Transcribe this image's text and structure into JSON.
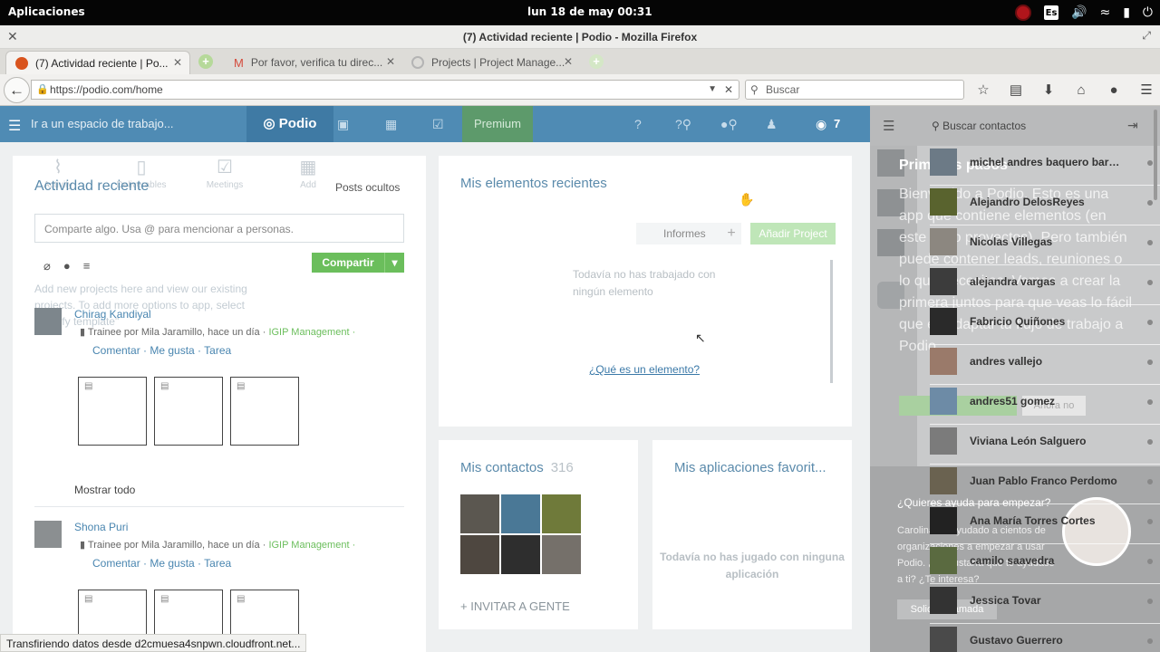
{
  "os_bar": {
    "apps_label": "Aplicaciones",
    "clock": "lun 18 de may   00:31",
    "kbd_layout": "Es"
  },
  "window": {
    "title": "(7) Actividad reciente | Podio - Mozilla Firefox"
  },
  "tabs": [
    {
      "label": "(7) Actividad reciente | Po...",
      "active": true,
      "favicon_color": "#d9541e"
    },
    {
      "label": "Por favor, verifica tu direc...",
      "active": false,
      "favicon_color": "#d44b3c"
    },
    {
      "label": "Projects | Project Manage...",
      "active": false,
      "favicon_color": "#b4b4b4"
    }
  ],
  "navbar": {
    "url": "https://podio.com/home",
    "search_placeholder": "Buscar"
  },
  "podio_header": {
    "workspace_placeholder": "Ir a un espacio de trabajo...",
    "logo": "Podio",
    "premium": "Premium",
    "notifications_count": "7"
  },
  "activity": {
    "ghost_tabs": [
      "Activity",
      "Deliverables",
      "Meetings",
      "Add"
    ],
    "title": "Actividad reciente",
    "hidden_posts": "Posts ocultos",
    "share_placeholder": "Comparte algo. Usa @ para mencionar a personas.",
    "share_button": "Compartir",
    "ghost_text": "Add new projects here and view our existing projects. To add more options to app, select \"Modify template\"",
    "posts": [
      {
        "name": "Chirag Kandiyal",
        "meta": "Trainee por Mila Jaramillo, hace un día · ",
        "workspace": "IGIP Management ·",
        "actions": "Comentar · Me gusta · Tarea"
      },
      {
        "name": "Shona Puri",
        "meta": "Trainee por Mila Jaramillo, hace un día · ",
        "workspace": "IGIP Management ·",
        "actions": "Comentar · Me gusta · Tarea"
      }
    ],
    "show_all": "Mostrar todo"
  },
  "recent_items": {
    "title": "Mis elementos recientes",
    "reports": "Informes",
    "add_project": "Añadir Project",
    "empty": "Todavía no has trabajado con ningún elemento",
    "what_link": "¿Qué es un elemento?"
  },
  "contacts_card": {
    "title": "Mis contactos",
    "count": "316",
    "invite": "+ INVITAR A GENTE"
  },
  "apps_card": {
    "title": "Mis aplicaciones favorit...",
    "empty": "Todavía no has jugado con ninguna aplicación"
  },
  "status_bar": "Transfiriendo datos desde d2cmuesa4snpwn.cloudfront.net...",
  "sidebar": {
    "search_placeholder": "Buscar contactos",
    "ghost_heading": "Primeros pasos",
    "ghost_para": "Bienvenido a Podio. Esto es una app que contiene elementos (en este caso proyectos). Pero también puede contener leads, reuniones o lo que necesites. Vamos a crear la primera juntos para que veas lo fácil que es adaptar tu flujo de trabajo a Podio.",
    "ghost_btn_secondary": "Ahora no",
    "help_question": "¿Quieres ayuda para empezar?",
    "help_text": "Carolina ha ayudado a cientos de organizaciones a empezar a usar Podio. ¿Te gustaría que te ayudase a ti? ¿Te interesa?",
    "help_button": "Solicitar llamada",
    "contacts": [
      "michel andres baquero bara...",
      "Alejandro DelosReyes",
      "Nicolas Villegas",
      "alejandra vargas",
      "Fabricio Quiñones",
      "andres vallejo",
      "andres51 gomez",
      "Viviana León Salguero",
      "Juan Pablo Franco Perdomo",
      "Ana María Torres Cortes",
      "camilo saavedra",
      "Jessica Tovar",
      "Gustavo Guerrero"
    ]
  }
}
